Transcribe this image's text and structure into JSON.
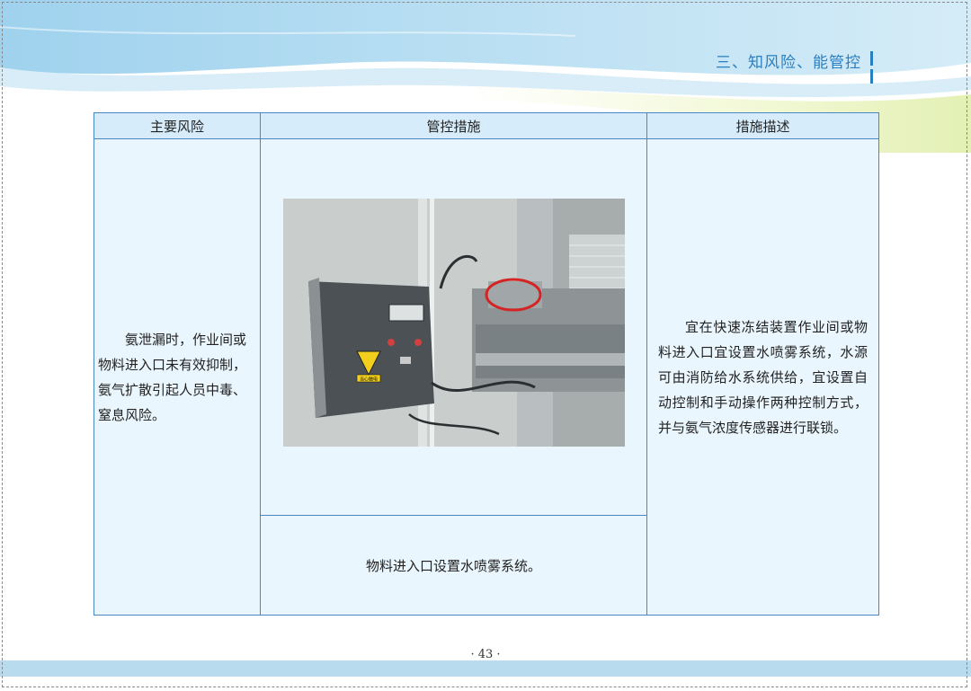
{
  "header": {
    "section_title": "三、知风险、能管控"
  },
  "table": {
    "headers": [
      "主要风险",
      "管控措施",
      "措施描述"
    ],
    "risk": "氨泄漏时，作业间或物料进入口未有效抑制，氨气扩散引起人员中毒、窒息风险。",
    "measure_caption": "物料进入口设置水喷雾系统。",
    "description": "宜在快速冻结装置作业间或物料进入口宜设置水喷雾系统，水源可由消防给水系统供给，宜设置自动控制和手动操作两种控制方式，并与氨气浓度传感器进行联锁。"
  },
  "photo": {
    "sign_text": "当心触电"
  },
  "footer": {
    "page_number": "· 43 ·"
  },
  "colors": {
    "accent": "#2a7fc0",
    "table_border": "#4a86c6",
    "header_fill": "#d7ecfa",
    "cell_fill": "#eaf6fd",
    "band": "#b9dbee"
  }
}
